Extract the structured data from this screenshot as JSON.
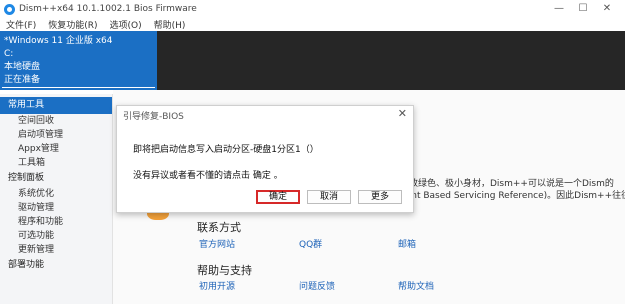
{
  "window": {
    "title": "Dism++x64 10.1.1002.1 Bios Firmware",
    "controls": [
      "—",
      "☐",
      "✕"
    ]
  },
  "menu": [
    "文件(F)",
    "恢复功能(R)",
    "选项(O)",
    "帮助(H)"
  ],
  "session": {
    "os": "*Windows 11 企业版 x64",
    "drive": "C:",
    "disk": "本地硬盘",
    "status": "正在准备"
  },
  "sidebar": {
    "groups": [
      {
        "label": "常用工具",
        "items": [
          "空间回收",
          "启动项管理",
          "Appx管理",
          "工具箱"
        ]
      },
      {
        "label": "控制面板",
        "items": [
          "系统优化",
          "驱动管理",
          "程序和功能",
          "可选功能",
          "更新管理"
        ]
      }
    ],
    "cut_label": "部署功能"
  },
  "main": {
    "body_lines": [
      "极致绿色、极小身材，Dism++可以说是一个Dism的",
      "nent Based Servicing Reference)。因此Dism++往往"
    ],
    "contact": {
      "title": "联系方式",
      "links": [
        "官方网站",
        "QQ群",
        "邮箱"
      ]
    },
    "help": {
      "title": "帮助与支持",
      "links": [
        "初用开源",
        "问题反馈",
        "帮助文档"
      ]
    }
  },
  "dialog": {
    "title": "引导修复-BIOS",
    "close": "✕",
    "message1": "即将把启动信息写入启动分区-硬盘1分区1（）",
    "message2": "没有异议或者看不懂的请点击 确定 。",
    "buttons": {
      "ok": "确定",
      "cancel": "取消",
      "more": "更多"
    },
    "highlight_color": "#d62828"
  },
  "colors": {
    "accent": "#1b6fc4",
    "dark": "#262626"
  }
}
